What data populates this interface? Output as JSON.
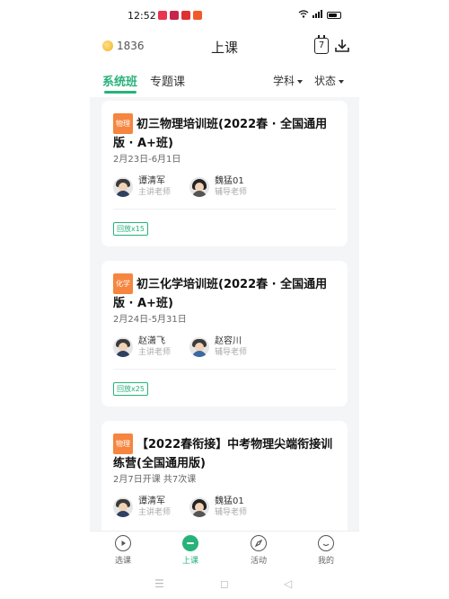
{
  "status_bar": {
    "time": "12:52",
    "app_colors": [
      "#e8344e",
      "#e8344e",
      "#e03030",
      "#f05a28"
    ]
  },
  "header": {
    "coins": "1836",
    "title": "上课",
    "calendar_day": "7"
  },
  "tabs": [
    {
      "label": "系统班",
      "active": true
    },
    {
      "label": "专题课",
      "active": false
    }
  ],
  "filters": [
    {
      "label": "学科"
    },
    {
      "label": "状态"
    }
  ],
  "colors": {
    "accent": "#27b27a",
    "physics_tag": "#f5853f",
    "chemistry_tag": "#f5853f"
  },
  "courses": [
    {
      "subject": "物理",
      "title": "初三物理培训班(2022春 · 全国通用版 · A+班)",
      "date": "2月23日-6月1日",
      "teachers": [
        {
          "name": "谭清军",
          "role": "主讲老师"
        },
        {
          "name": "魏猛01",
          "role": "辅导老师"
        }
      ],
      "replay": "回放x15"
    },
    {
      "subject": "化学",
      "title": "初三化学培训班(2022春 · 全国通用版 · A+班)",
      "date": "2月24日-5月31日",
      "teachers": [
        {
          "name": "赵潇飞",
          "role": "主讲老师"
        },
        {
          "name": "赵容川",
          "role": "辅导老师"
        }
      ],
      "replay": "回放x25"
    },
    {
      "subject": "物理",
      "title": "【2022春衔接】中考物理尖端衔接训练营(全国通用版)",
      "date": "2月7日开课 共7次课",
      "teachers": [
        {
          "name": "谭清军",
          "role": "主讲老师"
        },
        {
          "name": "魏猛01",
          "role": "辅导老师"
        }
      ]
    }
  ],
  "bottom_nav": [
    {
      "label": "选课",
      "icon": "play-circle-icon",
      "active": false
    },
    {
      "label": "上课",
      "icon": "class-icon",
      "active": true
    },
    {
      "label": "活动",
      "icon": "compass-icon",
      "active": false
    },
    {
      "label": "我的",
      "icon": "smile-icon",
      "active": false
    }
  ]
}
